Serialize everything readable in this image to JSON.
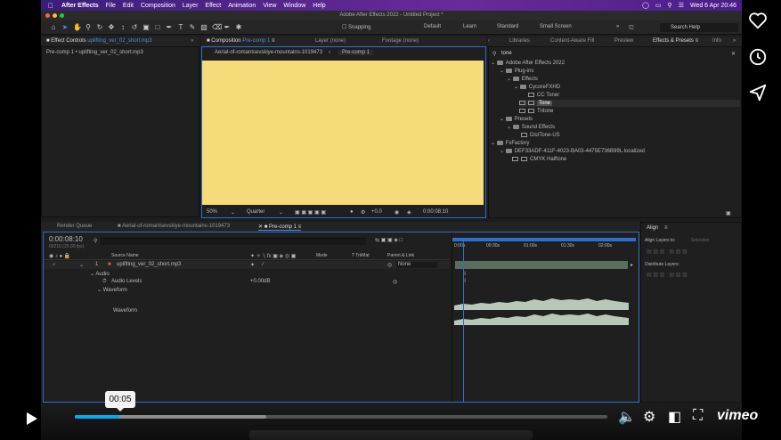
{
  "menubar": {
    "apple": "",
    "app_name": "After Effects",
    "items": [
      "File",
      "Edit",
      "Composition",
      "Layer",
      "Effect",
      "Animation",
      "View",
      "Window",
      "Help"
    ],
    "datetime": "Wed 6 Apr  20:46"
  },
  "window_title": "Adobe After Effects 2022 - Untitled Project *",
  "toolbar": {
    "snapping": "Snapping",
    "workspaces": [
      "Default",
      "Learn",
      "Standard",
      "Small Screen"
    ],
    "search_help_placeholder": "Search Help"
  },
  "effect_controls": {
    "tab_label": "Effect Controls",
    "tab_file": "uplifting_ver_02_short.mp3",
    "subtitle": "Pre-comp 1 • uplifting_ver_02_short.mp3"
  },
  "composition": {
    "tab_label": "Composition",
    "tab_name": "Pre-comp 1",
    "layer_tab": "Layer (none)",
    "footage_tab": "Footage (none)",
    "breadcrumb_1": "Aerial-of-romantsevskiye-mountains-1019473",
    "breadcrumb_2": "Pre-comp 1",
    "zoom": "50%",
    "resolution": "Quarter",
    "exposure": "+0.0",
    "timecode": "0:00:08:10",
    "background_color": "#f6db7a"
  },
  "effects_presets": {
    "tabs": [
      "Libraries",
      "Content-Aware Fill",
      "Preview",
      "Effects & Presets",
      "Info"
    ],
    "search_value": "tone",
    "tree": [
      {
        "label": "Adobe After Effects 2022",
        "indent": 0,
        "kind": "folder"
      },
      {
        "label": "Plug-ins",
        "indent": 1,
        "kind": "folder"
      },
      {
        "label": "Effects",
        "indent": 2,
        "kind": "folder"
      },
      {
        "label": "CycoreFXHD",
        "indent": 3,
        "kind": "folder"
      },
      {
        "label": "CC Toner",
        "indent": 4,
        "kind": "fx"
      },
      {
        "label": "Tone",
        "indent": 4,
        "kind": "fx",
        "selected": true
      },
      {
        "label": "Tritone",
        "indent": 4,
        "kind": "fx"
      },
      {
        "label": "Presets",
        "indent": 1,
        "kind": "folder"
      },
      {
        "label": "Sound Effects",
        "indent": 2,
        "kind": "folder"
      },
      {
        "label": "DistTone-US",
        "indent": 3,
        "kind": "fx"
      },
      {
        "label": "FxFactory",
        "indent": 0,
        "kind": "folder"
      },
      {
        "label": "DEF33ADF-411F-4023-BA03-4475E736B99L.localized",
        "indent": 1,
        "kind": "folder"
      },
      {
        "label": "CMYK Halftone",
        "indent": 2,
        "kind": "fx"
      }
    ]
  },
  "timeline": {
    "tabs": [
      "Render Queue",
      "Aerial-of-romantsevskiye-mountains-1019473",
      "Pre-comp 1"
    ],
    "timecode": "0:00:08:10",
    "fps": "00210 (25.00 fps)",
    "columns": {
      "source_name": "Source Name",
      "mode": "Mode",
      "trkmat": "T  TrkMat",
      "parent": "Parent & Link"
    },
    "layer": {
      "number": "1",
      "name": "uplifting_ver_02_short.mp3",
      "parent": "None"
    },
    "audio_group": "Audio",
    "audio_levels_label": "Audio Levels",
    "audio_levels_value": "+0.00dB",
    "waveform_group": "Waveform",
    "waveform_label": "Waveform",
    "ruler": [
      "0:00s",
      "00:30s",
      "01:00s",
      "01:30s",
      "02:00s"
    ]
  },
  "align": {
    "title": "Align",
    "align_layers_to": "Align Layers to:",
    "selection": "Selection",
    "distribute_layers": "Distribute Layers:"
  },
  "player": {
    "current_time": "00:05",
    "progress_fraction": 0.084,
    "buffered_fraction": 0.36,
    "brand": "vimeo"
  }
}
